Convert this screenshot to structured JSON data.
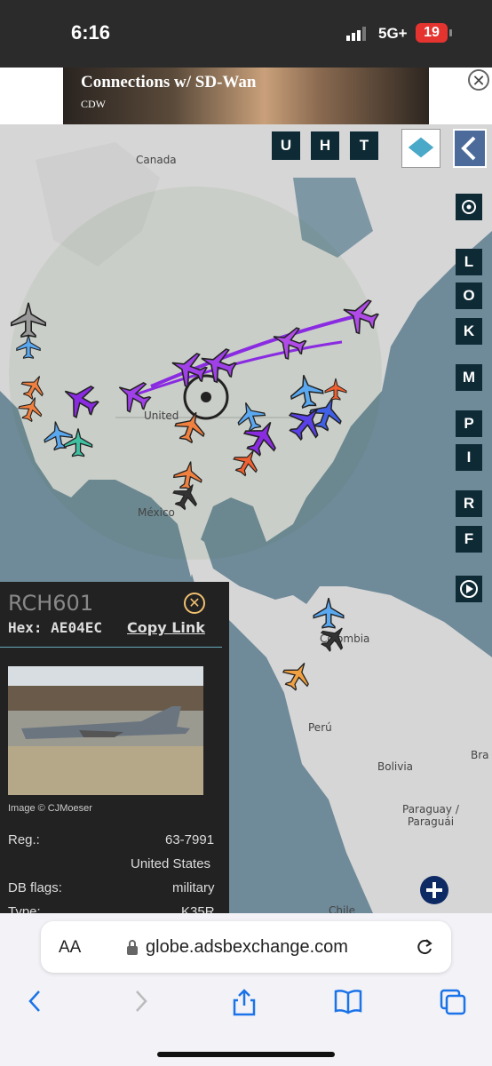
{
  "status_bar": {
    "time": "6:16",
    "network": "5G+",
    "battery": "19"
  },
  "ad": {
    "headline": "Connections w/ SD-Wan",
    "sponsor": "CDW",
    "close_icon": "close-circle-icon"
  },
  "map": {
    "labels": {
      "canada": "Canada",
      "united_states": "United",
      "mexico": "México",
      "colombia": "Colombia",
      "peru": "Perú",
      "bolivia": "Bolivia",
      "paraguay": "Paraguay /\nParaguái",
      "brazil": "Bra",
      "chile": "Chile"
    },
    "top_buttons": [
      "U",
      "H",
      "T"
    ],
    "side_buttons": [
      "L",
      "O",
      "K",
      "M",
      "P",
      "I",
      "R",
      "F"
    ],
    "icons": {
      "layers": "layers-icon",
      "back": "chevron-left-icon",
      "settings": "gear-icon",
      "replay": "replay-icon",
      "zoom_in": "plus-icon"
    }
  },
  "aircraft_panel": {
    "callsign": "RCH601",
    "hex_label": "Hex:",
    "hex_value": "AE04EC",
    "copy_link": "Copy Link",
    "image_credit": "Image © CJMoeser",
    "reg_label": "Reg.:",
    "reg_value": "63-7991",
    "country": "United States",
    "db_flags_label": "DB flags:",
    "db_flags_value": "military",
    "type_label": "Type:",
    "type_value": "K35R"
  },
  "browser": {
    "text_size": "AA",
    "url": "globe.adsbexchange.com"
  },
  "colors": {
    "map_water": "#6f8a99",
    "land": "#d6d6d6",
    "panel_bg": "#222222",
    "track": "#8a2be2",
    "button_bg": "#0e2a35"
  }
}
